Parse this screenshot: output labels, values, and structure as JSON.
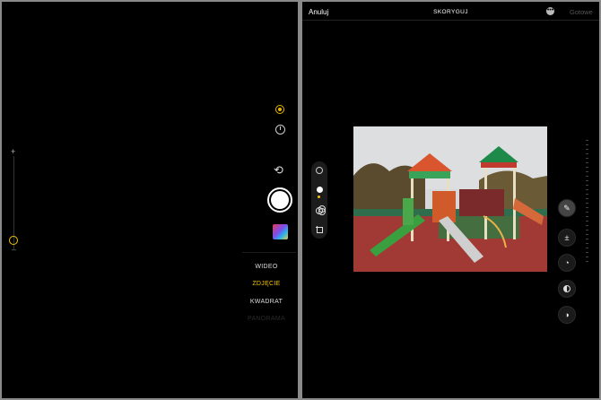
{
  "camera": {
    "zoom": {
      "plus": "+",
      "minus": "–"
    },
    "modes": {
      "video": "WIDEO",
      "photo": "ZDJĘCIE",
      "square": "KWADRAT",
      "faint": "PANORAMA"
    },
    "selected_mode": "ZDJĘCIE",
    "icons": {
      "live": "live-photo-icon",
      "timer": "timer-icon",
      "switch": "switch-camera-icon",
      "shutter": "shutter-button",
      "thumbnail": "last-photo-thumbnail"
    }
  },
  "editor": {
    "cancel_label": "Anuluj",
    "title": "SKORYGUJ",
    "more_label": "•••",
    "done_label": "Gotowe",
    "left_tools": [
      "live-photo-icon",
      "adjust-icon",
      "filters-icon",
      "crop-icon"
    ],
    "right_tools": [
      "auto-enhance-icon",
      "exposure-icon",
      "brilliance-icon",
      "highlights-icon",
      "shadows-icon"
    ],
    "photo": {
      "subject": "playground"
    }
  },
  "colors": {
    "accent": "#f5c400",
    "background": "#000000",
    "divider": "#8a8a8a"
  }
}
